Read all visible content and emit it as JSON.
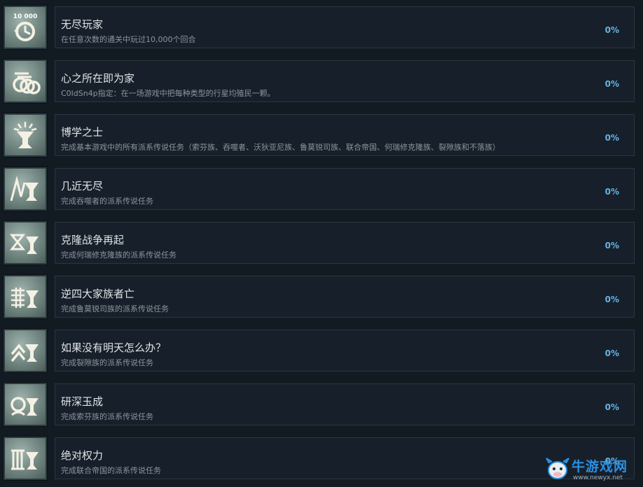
{
  "achievements": [
    {
      "title": "无尽玩家",
      "description": "在任意次数的通关中玩过10,000个回合",
      "progress": "0%",
      "icon_badge": "10 000",
      "icon": "turns-clock-icon"
    },
    {
      "title": "心之所在即为家",
      "description": "C0ldSn4p指定：在一场游戏中把每种类型的行星均殖民一颗。",
      "progress": "0%",
      "icon": "planets-icon"
    },
    {
      "title": "博学之士",
      "description": "完成基本游戏中的所有派系传说任务（索芬族、吞噬者、沃狄亚尼族、鲁莫锐司族、联合帝国、何瑞修克隆族、裂隙族和不落族）",
      "progress": "0%",
      "icon": "chalice-rays-icon"
    },
    {
      "title": "几近无尽",
      "description": "完成吞噬者的派系传说任务",
      "progress": "0%",
      "icon": "cravers-chalice-icon"
    },
    {
      "title": "克隆战争再起",
      "description": "完成何瑞修克隆族的派系传说任务",
      "progress": "0%",
      "icon": "horatio-chalice-icon"
    },
    {
      "title": "逆四大家族者亡",
      "description": "完成鲁莫锐司族的派系传说任务",
      "progress": "0%",
      "icon": "lumeris-chalice-icon"
    },
    {
      "title": "如果没有明天怎么办？",
      "description": "完成裂隙族的派系传说任务",
      "progress": "0%",
      "icon": "riftborn-chalice-icon"
    },
    {
      "title": "研深玉成",
      "description": "完成索芬族的派系传说任务",
      "progress": "0%",
      "icon": "sophon-chalice-icon"
    },
    {
      "title": "绝对权力",
      "description": "完成联合帝国的派系传说任务",
      "progress": "0%",
      "icon": "empire-chalice-icon"
    }
  ],
  "watermark": {
    "title": "牛游戏网",
    "url": "www.newyx.net",
    "icon": "cow-mascot-icon"
  },
  "colors": {
    "background": "#121a22",
    "panel": "#17202a",
    "panel_border": "#2b3640",
    "title": "#dfe3e6",
    "description": "#8c959c",
    "progress": "#66b4e6",
    "watermark": "#2b8fe0"
  }
}
